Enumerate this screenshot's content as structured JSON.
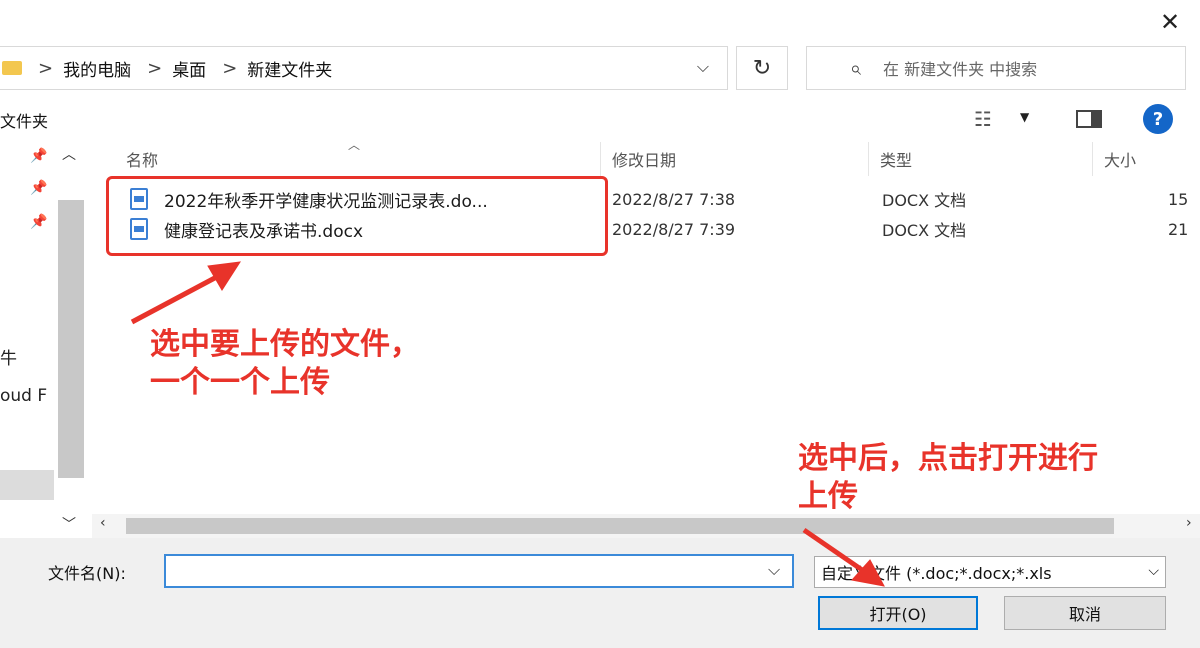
{
  "window": {
    "close_glyph": "✕"
  },
  "address": {
    "crumbs": [
      "我的电脑",
      "桌面",
      "新建文件夹"
    ],
    "separator": ">",
    "dropdown_glyph": "⌵",
    "refresh_glyph": "↻"
  },
  "search": {
    "placeholder": "在 新建文件夹 中搜索"
  },
  "toolbar": {
    "new_folder_label": "文件夹",
    "help_glyph": "?"
  },
  "nav_pane": {
    "partial_labels": [
      "牛",
      "oud F"
    ]
  },
  "file_list": {
    "columns": {
      "name": "名称",
      "modified": "修改日期",
      "type": "类型",
      "size": "大小"
    },
    "rows": [
      {
        "name": "2022年秋季开学健康状况监测记录表.do...",
        "modified": "2022/8/27 7:38",
        "type": "DOCX 文档",
        "size": "15"
      },
      {
        "name": "健康登记表及承诺书.docx",
        "modified": "2022/8/27 7:39",
        "type": "DOCX 文档",
        "size": "21"
      }
    ]
  },
  "bottom": {
    "filename_label": "文件名(N):",
    "filename_value": "",
    "filter_value": "自定义文件 (*.doc;*.docx;*.xls",
    "open_label": "打开(O)",
    "cancel_label": "取消"
  },
  "annotations": {
    "select_line1": "选中要上传的文件，",
    "select_line2": "一个一个上传",
    "open_line1": "选中后，点击打开进行",
    "open_line2": "上传",
    "color": "#e8332a"
  },
  "colors": {
    "accent": "#0078d7",
    "help": "#1466c8",
    "folder": "#f3c74f"
  }
}
